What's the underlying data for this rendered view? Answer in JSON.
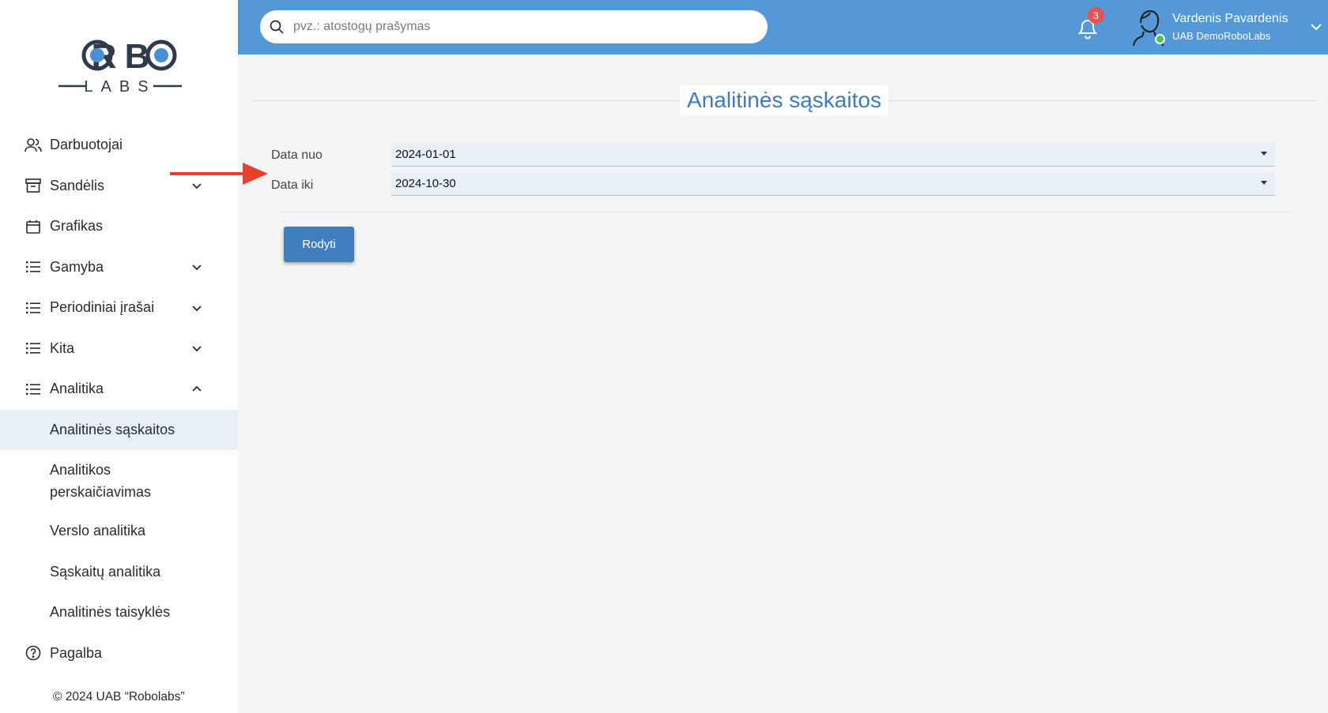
{
  "logo": {
    "top": "ROBO",
    "bottom": "LABS"
  },
  "sidebar": {
    "items": [
      {
        "label": "Darbuotojai",
        "icon": "users-icon"
      },
      {
        "label": "Sandėlis",
        "icon": "archive-icon",
        "expandable": true
      },
      {
        "label": "Grafikas",
        "icon": "calendar-icon"
      },
      {
        "label": "Gamyba",
        "icon": "list-icon",
        "expandable": true
      },
      {
        "label": "Periodiniai įrašai",
        "icon": "list-icon",
        "expandable": true
      },
      {
        "label": "Kita",
        "icon": "list-icon",
        "expandable": true
      },
      {
        "label": "Analitika",
        "icon": "list-icon",
        "expanded": true
      }
    ],
    "subitems": [
      {
        "label": "Analitinės sąskaitos",
        "active": true
      },
      {
        "label_line1": "Analitikos",
        "label_line2": "perskaičiavimas"
      },
      {
        "label": "Verslo analitika"
      },
      {
        "label": "Sąskaitų analitika"
      },
      {
        "label": "Analitinės taisyklės"
      }
    ],
    "help": {
      "label": "Pagalba",
      "icon": "help-circle-icon"
    },
    "copyright": "© 2024 UAB “Robolabs”"
  },
  "header": {
    "search_placeholder": "pvz.: atostogų prašymas",
    "notification_count": "3",
    "user_name": "Vardenis Pavardenis",
    "user_company": "UAB DemoRoboLabs"
  },
  "main": {
    "title": "Analitinės sąskaitos",
    "date_from_label": "Data nuo",
    "date_from_value": "2024-01-01",
    "date_to_label": "Data iki",
    "date_to_value": "2024-10-30",
    "show_button": "Rodyti"
  },
  "colors": {
    "accent": "#5498d6",
    "button": "#3f7fbf",
    "title": "#3d7bbd",
    "active_bg": "#e8f0f7",
    "arrow": "#e8402a",
    "badge": "#e35353",
    "online": "#4cc259"
  }
}
